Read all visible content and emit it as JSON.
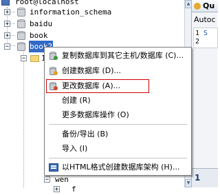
{
  "tree": {
    "root": "root@localhost",
    "databases": [
      "information_schema",
      "baidu",
      "book",
      "book2"
    ],
    "child_partial": "1",
    "wen_label": "wen",
    "last_partial": "f"
  },
  "query_panel": {
    "tab_label": "Qu",
    "autocomplete_label": "Autoc",
    "line_numbers": [
      "1",
      "2"
    ],
    "line1_snippet": "S",
    "bottom_number": "1"
  },
  "context_menu": {
    "items": [
      {
        "label": "复制数据库到其它主机/数据库 (C)...",
        "icon": "copy-db-icon"
      },
      {
        "label": "创建数据库 (D)...",
        "icon": "create-db-icon"
      },
      {
        "label": "更改数据库 (A)...",
        "icon": "alter-db-icon",
        "highlighted": true
      },
      {
        "label": "创建 (R)",
        "icon": ""
      },
      {
        "label": "更多数据库操作 (O)",
        "icon": ""
      },
      {
        "label": "备份/导出 (B)",
        "icon": ""
      },
      {
        "label": "导入 (I)",
        "icon": ""
      },
      {
        "label": "以HTML格式创建数据库架构 (H)...",
        "icon": "html-schema-icon"
      }
    ]
  },
  "colors": {
    "selection": "#316ac5",
    "highlight_box": "#cc0000"
  }
}
